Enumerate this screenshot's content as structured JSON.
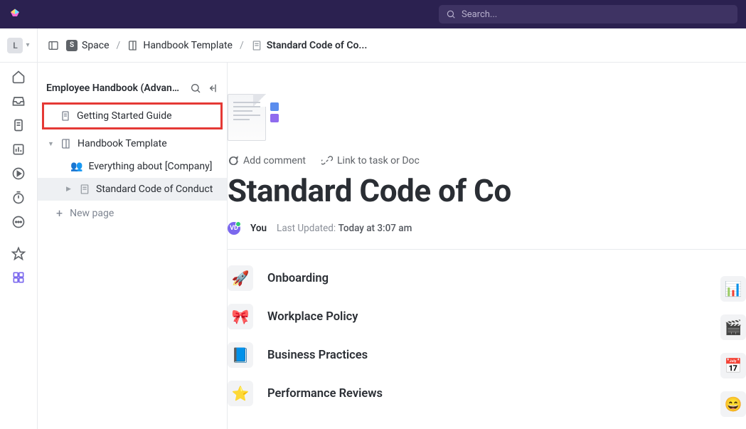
{
  "search": {
    "placeholder": "Search..."
  },
  "workspace_initial": "L",
  "breadcrumbs": {
    "items": [
      {
        "label": "Space"
      },
      {
        "label": "Handbook Template"
      },
      {
        "label": "Standard Code of Co..."
      }
    ]
  },
  "sidebar": {
    "title": "Employee Handbook (Advanc...",
    "tree": {
      "getting_started": "Getting Started Guide",
      "handbook_template": "Handbook Template",
      "everything_about": "Everything about [Company]",
      "standard_code": "Standard Code of Conduct"
    },
    "new_page": "New page"
  },
  "doc": {
    "add_comment": "Add comment",
    "link_task": "Link to task or Doc",
    "title": "Standard Code of Co",
    "author": "You",
    "updated_label": "Last Updated:",
    "updated_value": "Today at 3:07 am",
    "sections": [
      {
        "emoji": "🚀",
        "label": "Onboarding"
      },
      {
        "emoji": "🎀",
        "label": "Workplace Policy"
      },
      {
        "emoji": "📘",
        "label": "Business Practices"
      },
      {
        "emoji": "⭐",
        "label": "Performance Reviews"
      }
    ],
    "right_icons": [
      "📊",
      "🎬",
      "📅",
      "😄"
    ]
  }
}
